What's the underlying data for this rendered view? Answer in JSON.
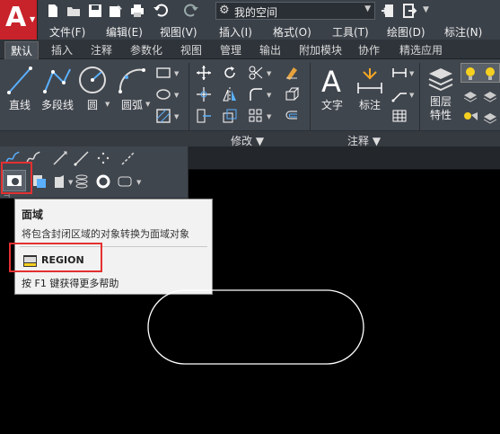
{
  "workspace": {
    "label": "我的空间"
  },
  "menu": [
    "文件(F)",
    "编辑(E)",
    "视图(V)",
    "插入(I)",
    "格式(O)",
    "工具(T)",
    "绘图(D)",
    "标注(N)"
  ],
  "tabs": [
    "默认",
    "插入",
    "注释",
    "参数化",
    "视图",
    "管理",
    "输出",
    "附加模块",
    "协作",
    "精选应用"
  ],
  "ribbon": {
    "line": "直线",
    "polyline": "多段线",
    "circle": "圆",
    "arc": "圆弧",
    "text": "文字",
    "dimension": "标注",
    "layer_props": "图层\n特性",
    "layer_props_l1": "图层",
    "layer_props_l2": "特性"
  },
  "panels": {
    "modify": "修改",
    "annotate": "注释"
  },
  "tooltip": {
    "title": "面域",
    "description": "将包含封闭区域的对象转换为面域对象",
    "command": "REGION",
    "help": "按 F1 键获得更多帮助"
  },
  "colors": {
    "highlight": "#e53030",
    "app_red": "#c8222a",
    "canvas": "#000000"
  }
}
